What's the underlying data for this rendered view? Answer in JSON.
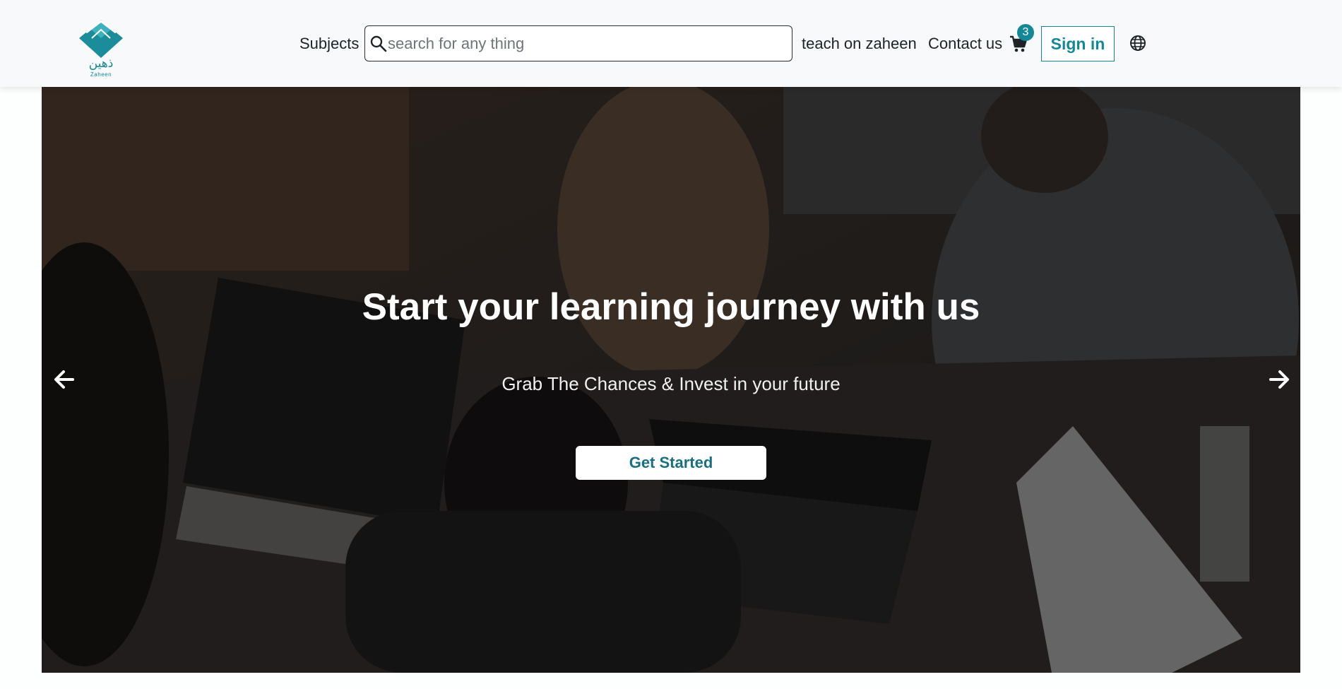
{
  "header": {
    "logo": {
      "arabic_text": "ذهين",
      "latin_text": "Zaheen"
    },
    "nav": {
      "subjects": "Subjects",
      "teach": "teach on zaheen",
      "contact": "Contact us"
    },
    "search": {
      "placeholder": "search for any thing",
      "value": ""
    },
    "cart": {
      "count": "3"
    },
    "signin_label": "Sign in",
    "icons": [
      "logo-book-icon",
      "search-icon",
      "cart-icon",
      "globe-icon"
    ],
    "colors": {
      "brand": "#158897",
      "nav_bg": "#f7f9fa"
    }
  },
  "hero": {
    "title": "Start your learning journey with us",
    "subtitle": "Grab The Chances & Invest in your future",
    "cta_label": "Get Started",
    "icons": [
      "arrow-left-icon",
      "arrow-right-icon"
    ]
  }
}
